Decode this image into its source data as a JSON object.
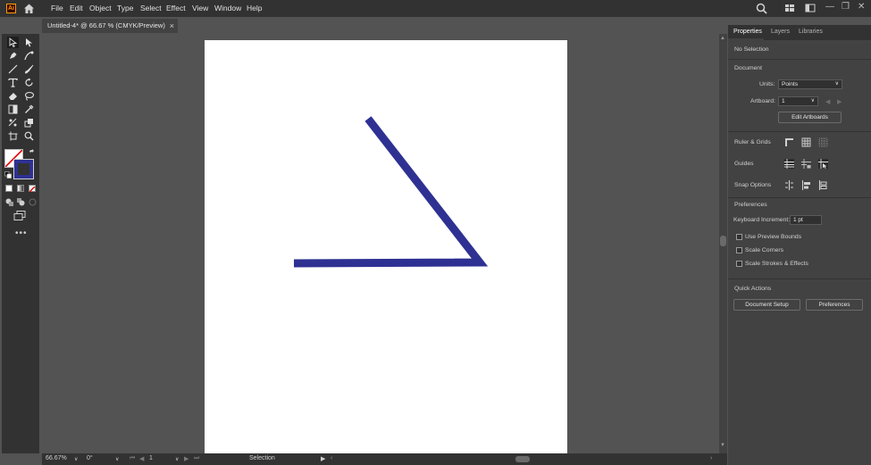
{
  "app": {
    "logo": "Ai"
  },
  "menu": [
    "File",
    "Edit",
    "Object",
    "Type",
    "Select",
    "Effect",
    "View",
    "Window",
    "Help"
  ],
  "window_controls": {
    "minimize": "—",
    "restore": "❐",
    "close": "✕"
  },
  "document_tab": {
    "title": "Untitled-4* @ 66.67 % (CMYK/Preview)",
    "close": "×"
  },
  "artwork": {
    "stroke_color": "#2e3192"
  },
  "status_bar": {
    "zoom": "66.67%",
    "rotation": "0°",
    "artboard_number": "1",
    "tool": "Selection"
  },
  "panel": {
    "tabs": [
      "Properties",
      "Layers",
      "Libraries"
    ],
    "selection": "No Selection",
    "document_heading": "Document",
    "units_label": "Units:",
    "units_value": "Points",
    "artboard_label": "Artboard:",
    "artboard_value": "1",
    "edit_artboards": "Edit Artboards",
    "ruler_grids": "Ruler & Grids",
    "guides": "Guides",
    "snap_options": "Snap Options",
    "preferences_heading": "Preferences",
    "keyboard_increment_label": "Keyboard Increment:",
    "keyboard_increment_value": "1 pt",
    "use_preview_bounds": "Use Preview Bounds",
    "scale_corners": "Scale Corners",
    "scale_strokes": "Scale Strokes & Effects",
    "quick_actions": "Quick Actions",
    "document_setup": "Document Setup",
    "preferences_button": "Preferences"
  }
}
